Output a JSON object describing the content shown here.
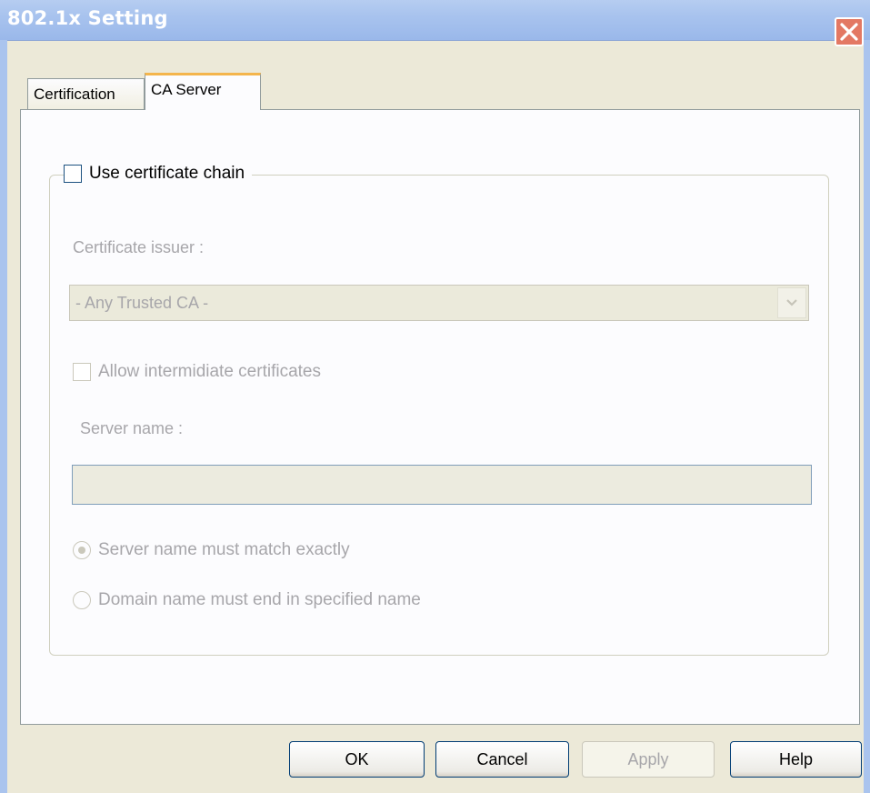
{
  "window": {
    "title": "802.1x Setting",
    "close_icon": "close-icon"
  },
  "tabs": [
    {
      "label": "Certification",
      "selected": false
    },
    {
      "label": "CA Server",
      "selected": true
    }
  ],
  "group": {
    "checkbox_label": "Use certificate chain",
    "checked": false,
    "certificate_issuer_label": "Certificate issuer :",
    "issuer_select_value": "- Any Trusted CA -",
    "allow_label": "Allow intermidiate certificates",
    "server_name_label": "Server name :",
    "server_name_value": "",
    "radio_options": [
      {
        "label": "Server name must match exactly",
        "selected": true
      },
      {
        "label": "Domain name must end in specified name",
        "selected": false
      }
    ]
  },
  "buttons": {
    "ok": "OK",
    "cancel": "Cancel",
    "apply": "Apply",
    "help": "Help"
  },
  "colors": {
    "title_bar": "#a8c3ee",
    "close_button": "#e37863",
    "tab_accent": "#f4b54c",
    "dialog_bg": "#ece9d8"
  }
}
